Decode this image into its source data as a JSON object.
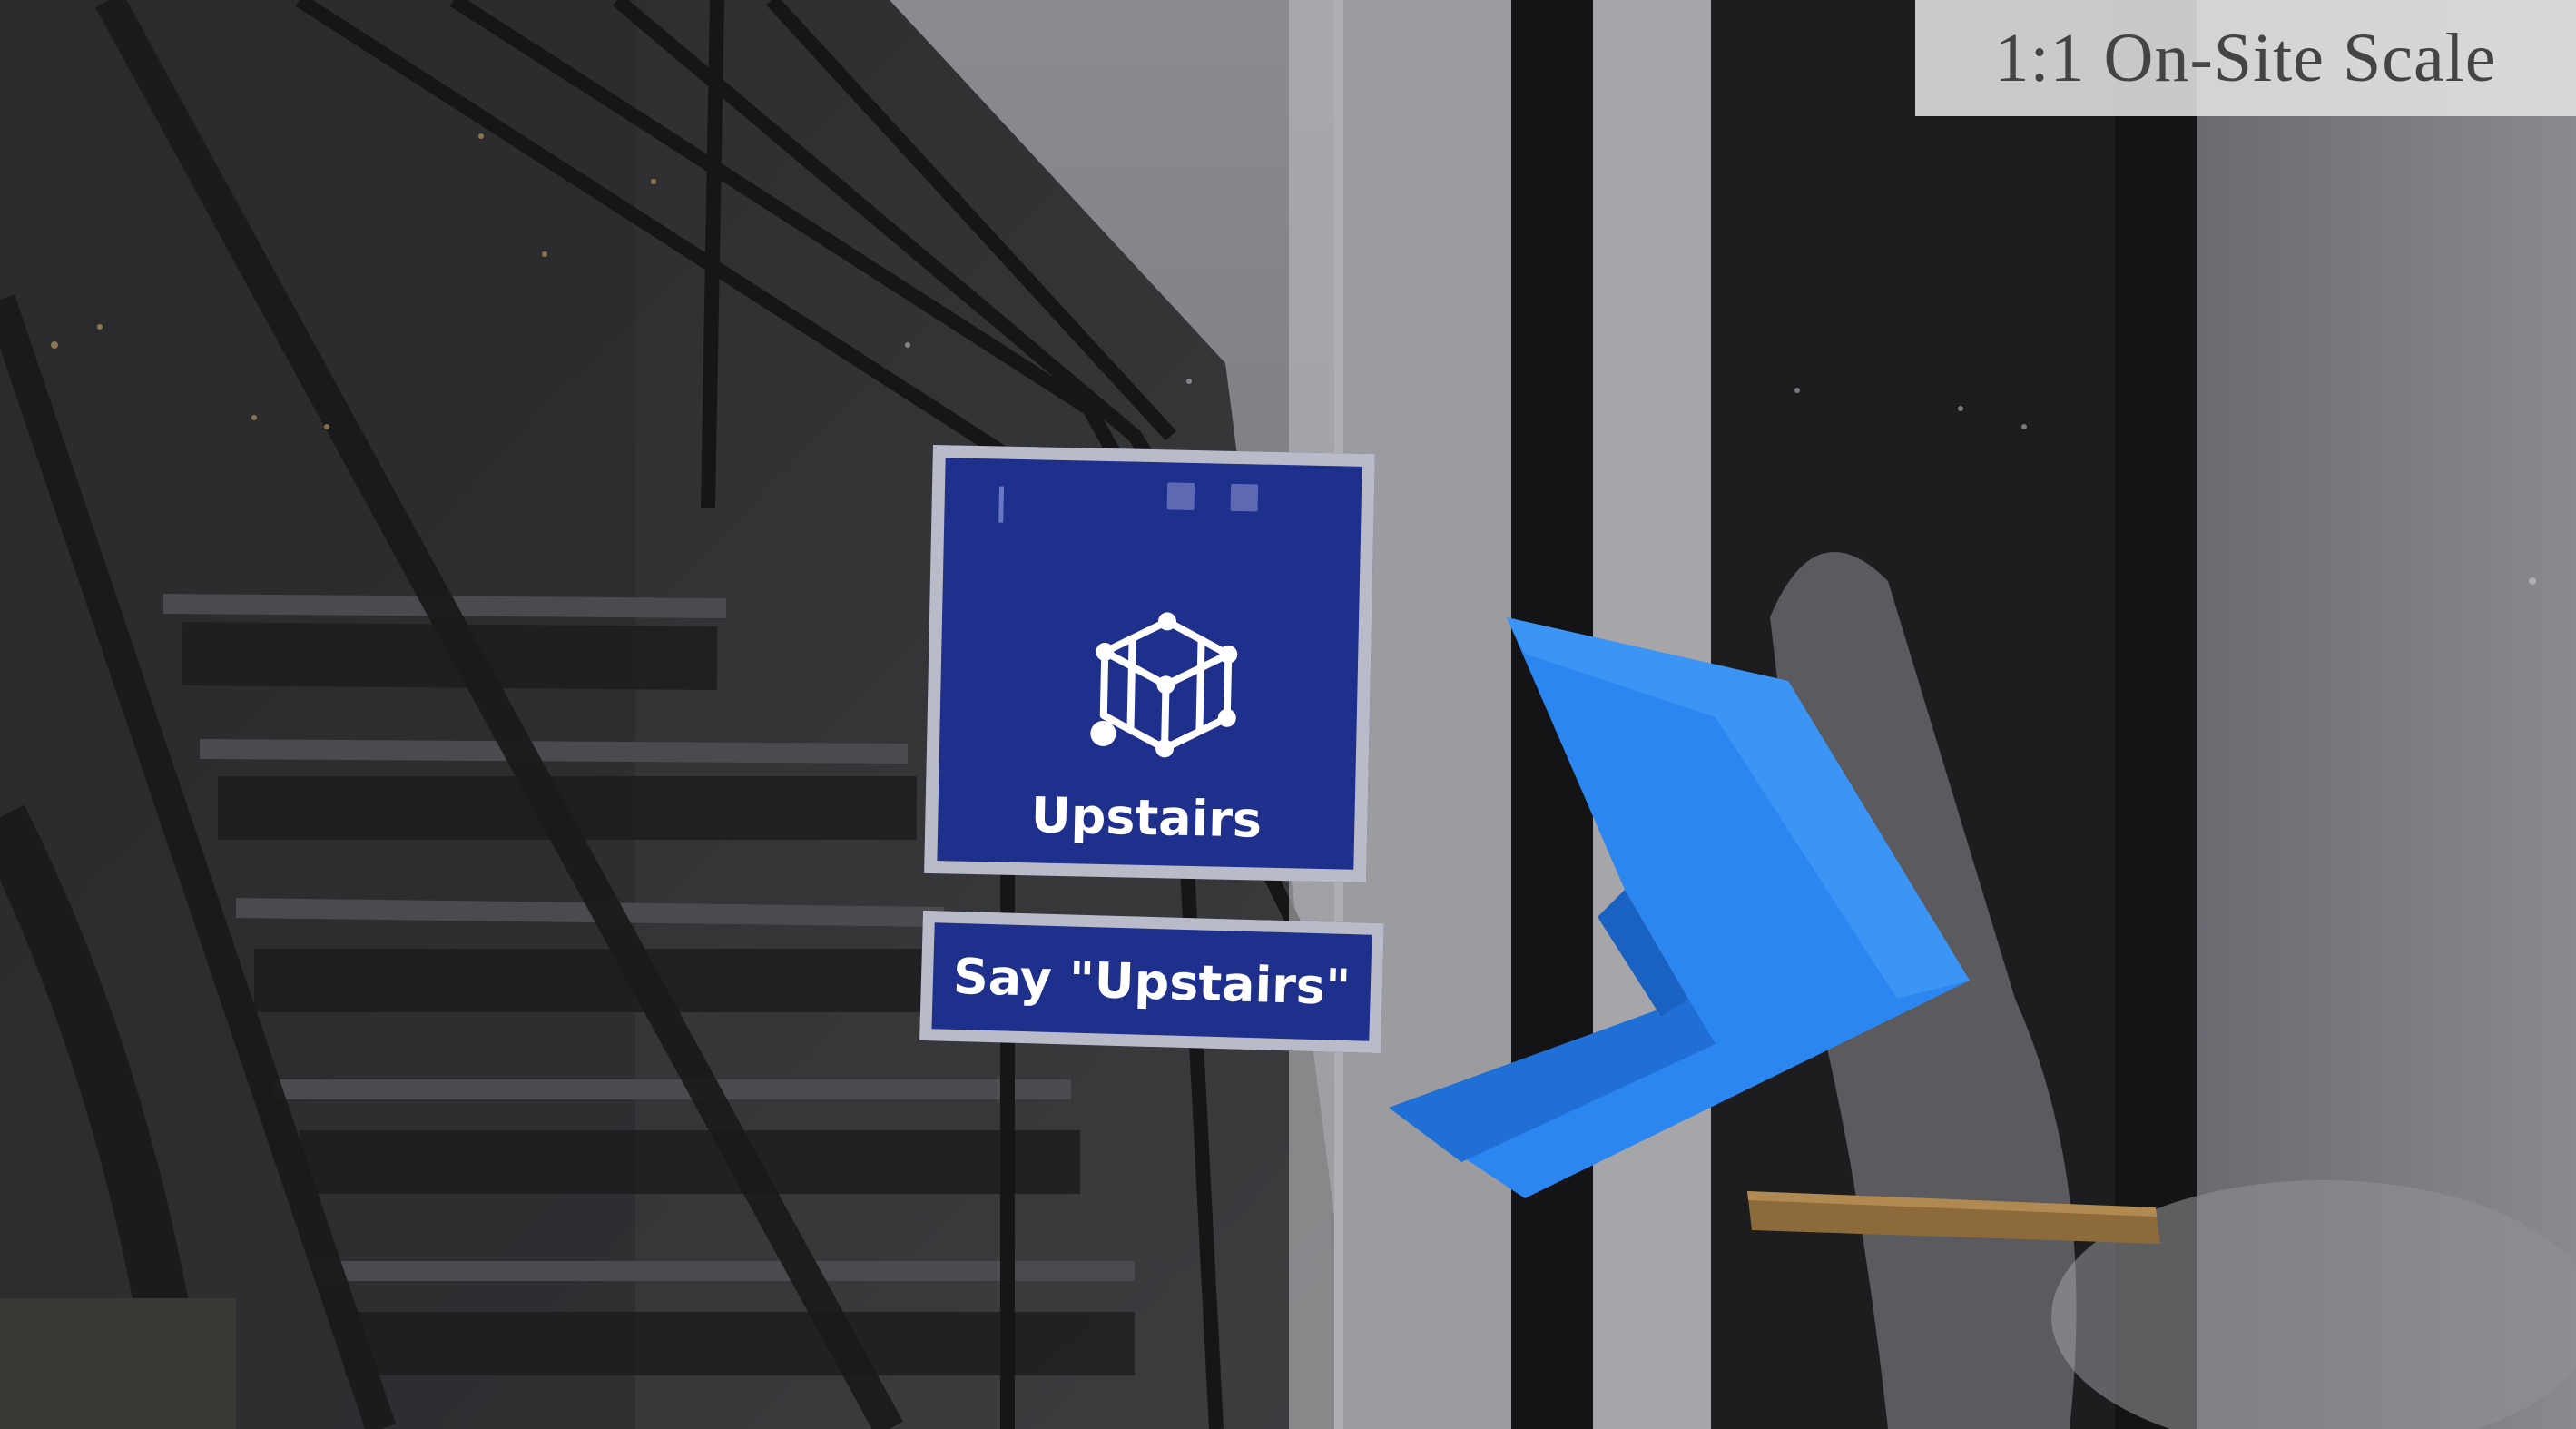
{
  "overlay": {
    "scale_badge": "1:1 On-Site Scale"
  },
  "waypoint": {
    "icon": "cube-icon",
    "label": "Upstairs",
    "voice_hint": "Say \"Upstairs\""
  },
  "direction_arrow": {
    "icon": "chevron-right-arrow-icon",
    "color": "#2b86f0"
  },
  "colors": {
    "tile_background": "#1f2f8c",
    "tile_border": "#b9bcc8",
    "badge_background": "#e2e2e2"
  }
}
